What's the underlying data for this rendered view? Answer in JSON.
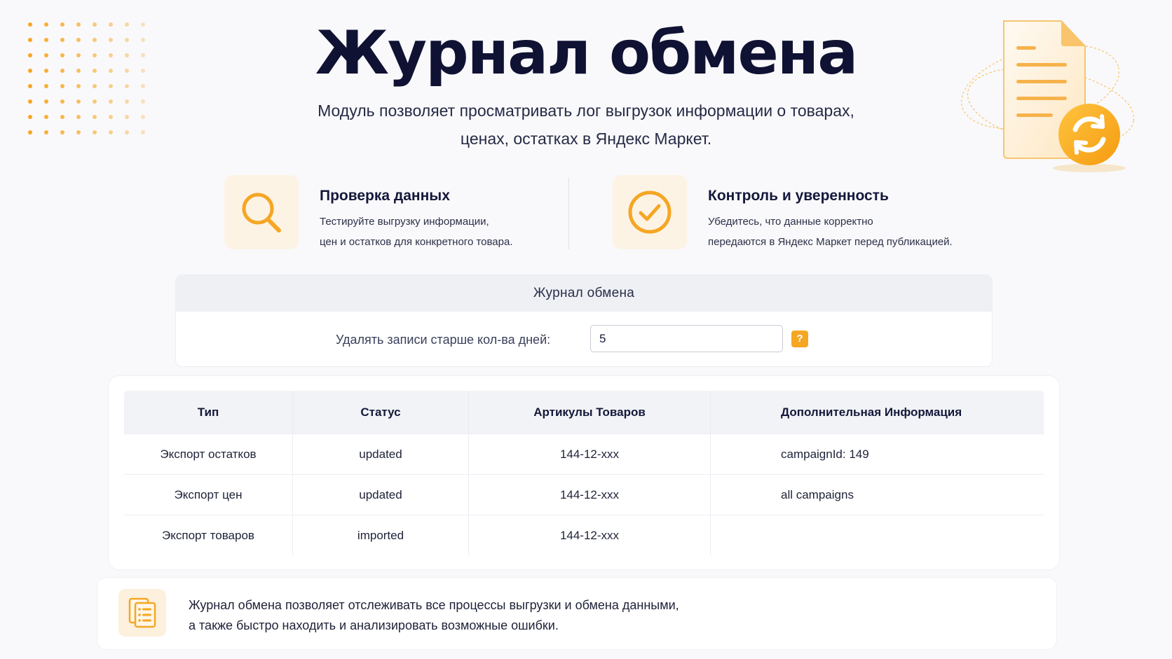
{
  "hero": {
    "title": "Журнал обмена",
    "subtitle_line1": "Модуль позволяет просматривать лог выгрузок информации о товарах,",
    "subtitle_line2": "ценах, остатках в Яндекс Маркет."
  },
  "features": [
    {
      "icon": "magnifier-icon",
      "title": "Проверка данных",
      "desc_line1": "Тестируйте выгрузку информации,",
      "desc_line2": "цен и остатков для конкретного товара."
    },
    {
      "icon": "check-circle-icon",
      "title": "Контроль и уверенность",
      "desc_line1": "Убедитесь, что данные корректно",
      "desc_line2": "передаются в Яндекс Маркет перед публикацией."
    }
  ],
  "settings": {
    "title": "Журнал обмена",
    "delete_label": "Удалять записи старше кол-ва дней:",
    "delete_value": "5",
    "help_label": "?"
  },
  "table": {
    "headers": [
      "Тип",
      "Статус",
      "Артикулы Товаров",
      "Дополнительная Информация"
    ],
    "rows": [
      [
        "Экспорт остатков",
        "updated",
        "144-12-xxx",
        "campaignId: 149"
      ],
      [
        "Экспорт цен",
        "updated",
        "144-12-xxx",
        "all campaigns"
      ],
      [
        "Экспорт товаров",
        "imported",
        "144-12-xxx",
        ""
      ]
    ]
  },
  "footer": {
    "icon": "document-list-icon",
    "text_line1": "Журнал обмена позволяет отслеживать все процессы выгрузки и обмена данными,",
    "text_line2": "а также быстро находить и анализировать возможные ошибки."
  },
  "colors": {
    "accent": "#f5a623",
    "title": "#0f1233",
    "background": "#f9f9fb"
  }
}
